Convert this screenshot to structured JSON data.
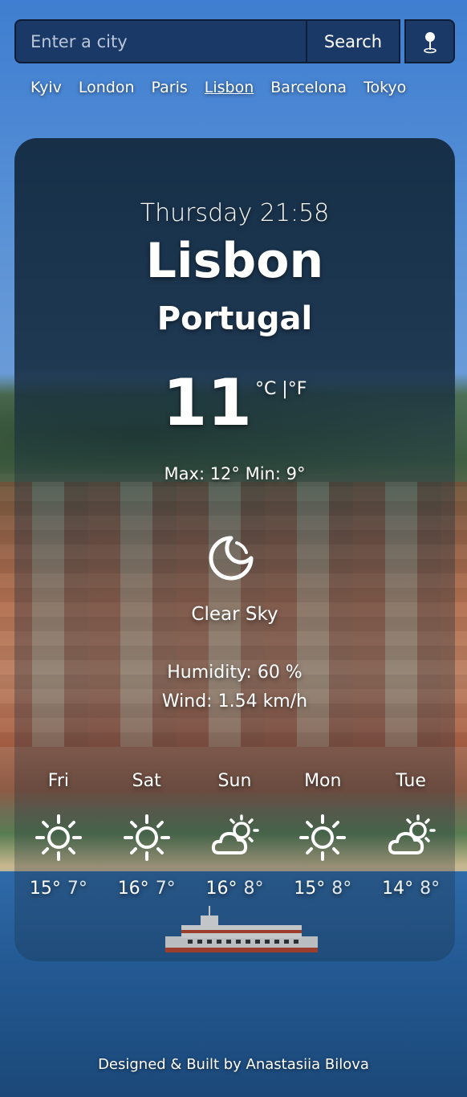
{
  "search": {
    "placeholder": "Enter a city",
    "button_label": "Search"
  },
  "cities": [
    "Kyiv",
    "London",
    "Paris",
    "Lisbon",
    "Barcelona",
    "Tokyo"
  ],
  "active_city": "Lisbon",
  "current": {
    "datetime": "Thursday 21:58",
    "city": "Lisbon",
    "country": "Portugal",
    "temperature": "11",
    "unit_c": "°C",
    "unit_sep": " |",
    "unit_f": "°F",
    "max_min": "Max: 12°  Min: 9°",
    "icon": "clear-sky-night-icon",
    "description": "Clear Sky",
    "humidity": "Humidity: 60 %",
    "wind": "Wind: 1.54 km/h"
  },
  "forecast": [
    {
      "day": "Fri",
      "icon": "sun-icon",
      "max": "15°",
      "min": "7°"
    },
    {
      "day": "Sat",
      "icon": "sun-icon",
      "max": "16°",
      "min": "7°"
    },
    {
      "day": "Sun",
      "icon": "sun-cloud-icon",
      "max": "16°",
      "min": "8°"
    },
    {
      "day": "Mon",
      "icon": "sun-icon",
      "max": "15°",
      "min": "8°"
    },
    {
      "day": "Tue",
      "icon": "sun-cloud-icon",
      "max": "14°",
      "min": "8°"
    }
  ],
  "footer": "Designed & Built by Anastasiia Bilova"
}
